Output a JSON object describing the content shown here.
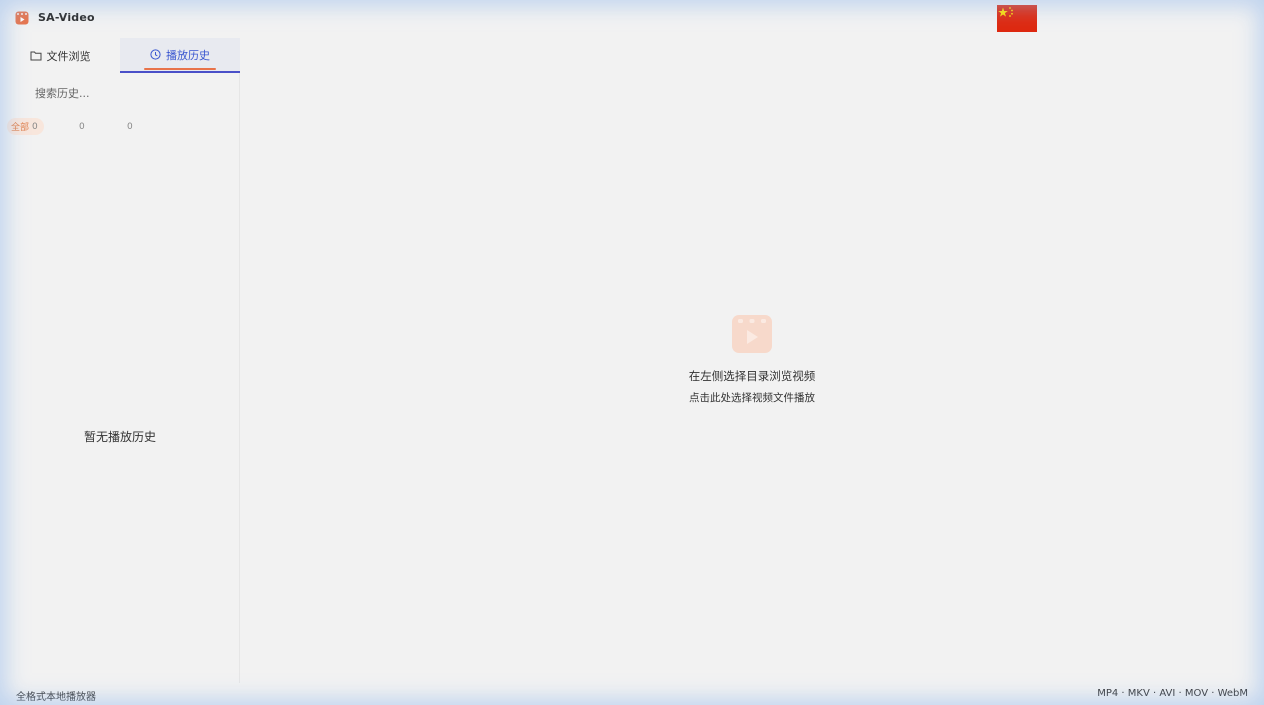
{
  "app": {
    "title": "SA-Video",
    "logo_icon": "film-icon",
    "accent": "#e8734a",
    "language_flag": "china-flag-icon"
  },
  "sidebar": {
    "tabs": [
      {
        "label": "文件浏览",
        "icon": "folder-icon",
        "active": false
      },
      {
        "label": "播放历史",
        "icon": "clock-icon",
        "active": true
      }
    ],
    "search_placeholder": "搜索历史...",
    "filters": [
      {
        "label": "全部",
        "count": "0",
        "active": true
      },
      {
        "label": "",
        "count": "0",
        "active": false
      },
      {
        "label": "",
        "count": "0",
        "active": false
      }
    ],
    "empty_text": "暂无播放历史"
  },
  "main": {
    "placeholder_icon": "film-icon",
    "line1": "在左侧选择目录浏览视频",
    "line2": "点击此处选择视频文件播放"
  },
  "status": {
    "left": "全格式本地播放器",
    "right": "MP4 · MKV · AVI · MOV · WebM"
  }
}
